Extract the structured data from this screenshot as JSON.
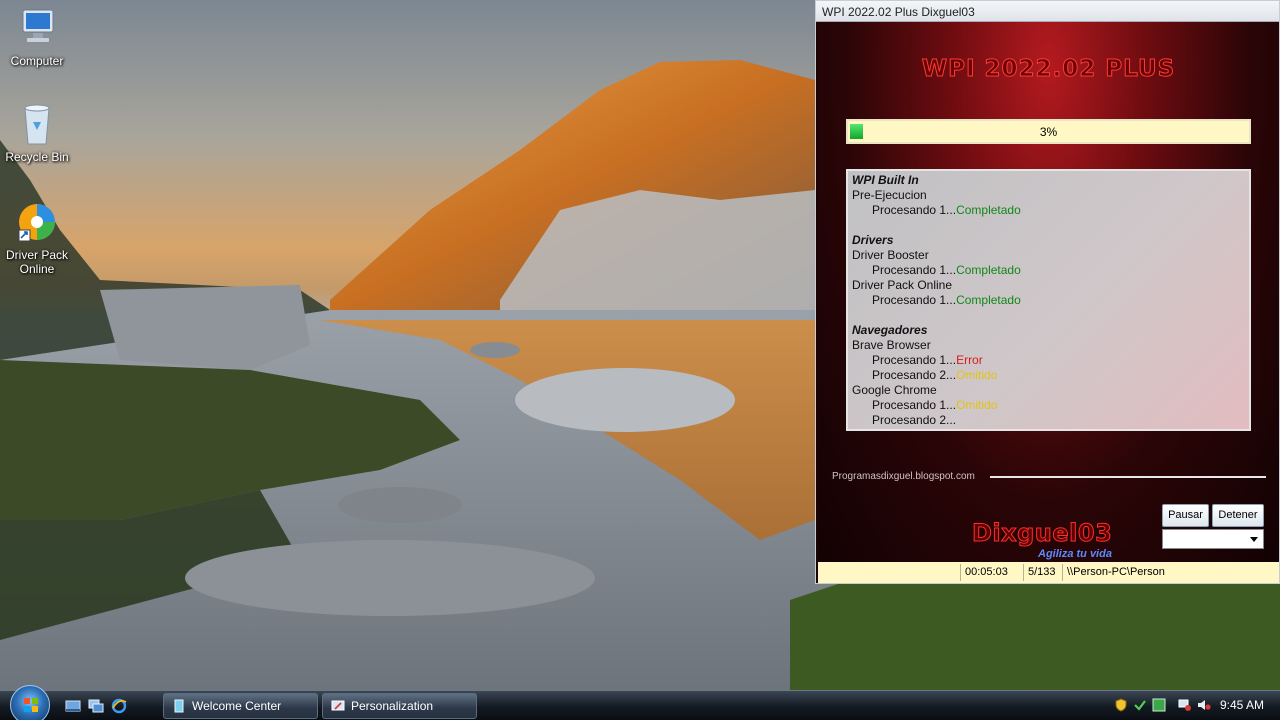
{
  "desktop": {
    "icons": [
      {
        "label": "Computer",
        "icon": "computer-icon"
      },
      {
        "label": "Recycle Bin",
        "icon": "recycle-bin-icon"
      },
      {
        "label": "Driver Pack\nOnline",
        "line1": "Driver Pack",
        "line2": "Online",
        "icon": "driverpack-icon"
      }
    ]
  },
  "wpi": {
    "title": "WPI 2022.02 Plus Dixguel03",
    "logo_text": "WPI 2022.02 PLUS",
    "progress": {
      "percent": 3,
      "label": "3%"
    },
    "log": {
      "rows": [
        {
          "text": "WPI Built In",
          "kind": "header"
        },
        {
          "text": "Pre-Ejecucion",
          "kind": "item"
        },
        {
          "text": "Procesando 1...",
          "status": "Completado",
          "kind": "sub"
        },
        {
          "kind": "gap"
        },
        {
          "text": "Drivers",
          "kind": "header"
        },
        {
          "text": "Driver Booster",
          "kind": "item"
        },
        {
          "text": "Procesando 1...",
          "status": "Completado",
          "kind": "sub"
        },
        {
          "text": "Driver Pack Online",
          "kind": "item"
        },
        {
          "text": "Procesando 1...",
          "status": "Completado",
          "kind": "sub"
        },
        {
          "kind": "gap"
        },
        {
          "text": "Navegadores",
          "kind": "header"
        },
        {
          "text": "Brave Browser",
          "kind": "item"
        },
        {
          "text": "Procesando 1...",
          "status": "Error",
          "kind": "sub"
        },
        {
          "text": "Procesando 2...",
          "status": "Omitido",
          "kind": "sub"
        },
        {
          "text": "Google Chrome",
          "kind": "item"
        },
        {
          "text": "Procesando 1...",
          "status": "Omitido",
          "kind": "sub"
        },
        {
          "text": "Procesando 2...",
          "status": "",
          "kind": "sub"
        }
      ]
    },
    "site": "Programasdixguel.blogspot.com",
    "brand": "Dixguel03",
    "tagline": "Agiliza tu vida",
    "buttons": {
      "pause": "Pausar",
      "stop": "Detener"
    },
    "select_value": "",
    "status": {
      "elapsed": "00:05:03",
      "count": "5/133",
      "user": "\\\\Person-PC\\Person"
    },
    "colors": {
      "ok": "#11871a",
      "error": "#d81b1b",
      "skipped": "#e4c21a"
    }
  },
  "taskbar": {
    "tasks": [
      {
        "label": "Welcome Center",
        "icon": "welcome-center-icon"
      },
      {
        "label": "Personalization",
        "icon": "personalization-icon"
      }
    ],
    "clock": "9:45 AM"
  }
}
